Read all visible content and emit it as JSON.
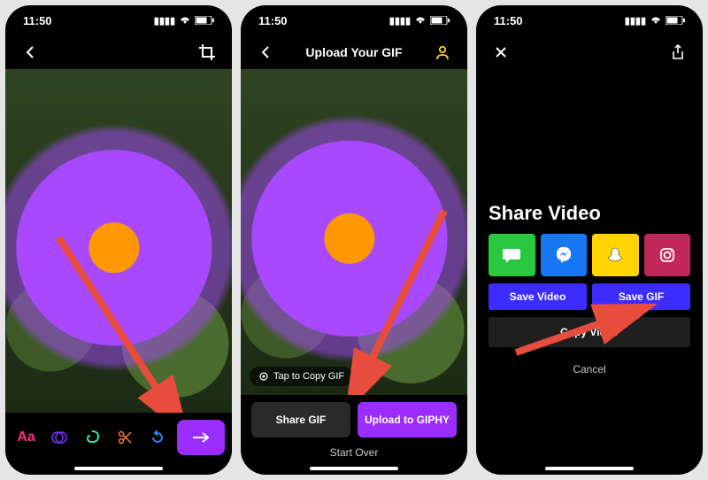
{
  "status": {
    "time": "11:50"
  },
  "screen1": {
    "toolbar": {
      "text_label": "Aa"
    }
  },
  "screen2": {
    "title": "Upload Your GIF",
    "tap_hint": "Tap to Copy GIF",
    "share_gif": "Share GIF",
    "upload_giphy": "Upload to GIPHY",
    "start_over": "Start Over"
  },
  "screen3": {
    "share_title": "Share Video",
    "save_video": "Save Video",
    "save_gif": "Save GIF",
    "copy_video": "Copy Video",
    "cancel": "Cancel"
  }
}
